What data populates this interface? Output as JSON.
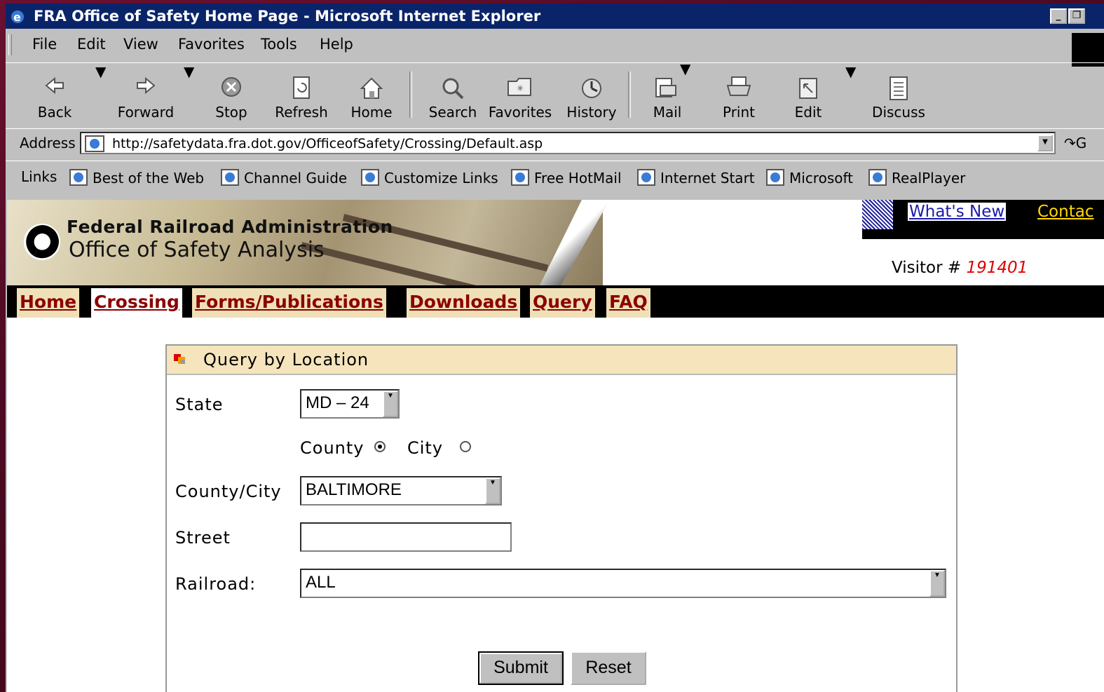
{
  "window": {
    "title": "FRA Office of Safety Home Page - Microsoft Internet Explorer"
  },
  "menu": [
    "File",
    "Edit",
    "View",
    "Favorites",
    "Tools",
    "Help"
  ],
  "toolbar": {
    "back": "Back",
    "forward": "Forward",
    "stop": "Stop",
    "refresh": "Refresh",
    "home": "Home",
    "search": "Search",
    "favorites": "Favorites",
    "history": "History",
    "mail": "Mail",
    "print": "Print",
    "edit": "Edit",
    "discuss": "Discuss"
  },
  "address": {
    "label": "Address",
    "url": "http://safetydata.fra.dot.gov/OfficeofSafety/Crossing/Default.asp",
    "go": "G"
  },
  "links": {
    "label": "Links",
    "items": [
      "Best of the Web",
      "Channel Guide",
      "Customize Links",
      "Free HotMail",
      "Internet Start",
      "Microsoft",
      "RealPlayer"
    ]
  },
  "banner": {
    "org_line1": "Federal Railroad Administration",
    "org_line2": "Office of Safety Analysis"
  },
  "topnav": {
    "whats_new": "What's New",
    "contact": "Contac"
  },
  "visitor": {
    "label": "Visitor # ",
    "number": "191401"
  },
  "nav": [
    "Home",
    "Crossing",
    "Forms/Publications",
    "Downloads",
    "Query",
    "FAQ"
  ],
  "form": {
    "title": "Query by Location",
    "state_label": "State",
    "state_value": "MD – 24",
    "county_radio_label": "County",
    "city_radio_label": "City",
    "selected_radio": "County",
    "county_city_label": "County/City",
    "county_city_value": "BALTIMORE",
    "street_label": "Street",
    "street_value": "",
    "railroad_label": "Railroad:",
    "railroad_value": "ALL",
    "submit": "Submit",
    "reset": "Reset"
  }
}
